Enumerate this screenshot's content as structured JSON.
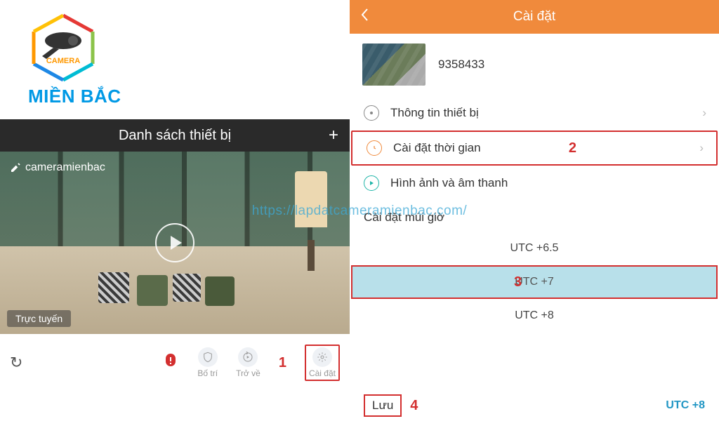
{
  "brand": "MIỀN BẮC",
  "logo_label": "CAMERA",
  "watermark": "https://lapdatcameramienbac.com/",
  "left": {
    "list_title": "Danh sách thiết bị",
    "camera_name": "cameramienbac",
    "status": "Trực tuyến",
    "toolbar": {
      "arrange": "Bố trí",
      "back": "Trở về",
      "settings": "Cài đặt",
      "annotation_1": "1"
    }
  },
  "right": {
    "header": "Cài đặt",
    "device_id": "9358433",
    "menu": {
      "info": "Thông tin thiết bị",
      "time": "Cài đặt thời gian",
      "media": "Hình ảnh và âm thanh",
      "annotation_2": "2"
    },
    "tz_title": "Cài đặt múi giờ",
    "tz_options": {
      "opt1": "UTC +6.5",
      "opt2": "UTC +7",
      "opt3": "UTC +8",
      "annotation_3": "3"
    },
    "save": "Lưu",
    "annotation_4": "4",
    "current_tz": "UTC +8"
  }
}
